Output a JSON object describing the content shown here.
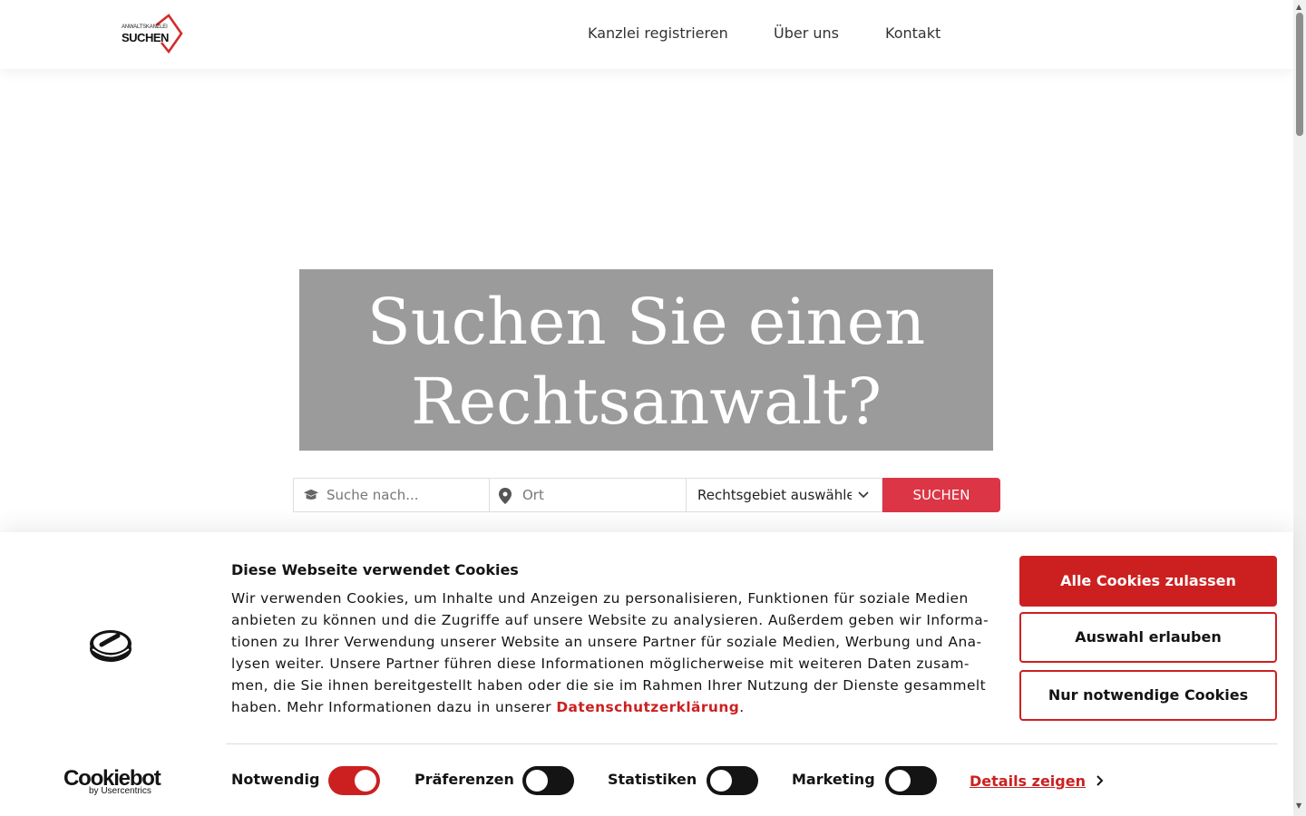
{
  "header": {
    "logo": {
      "top_text": "ANWALTSKANZLEI",
      "main_text": "SUCHEN"
    },
    "nav": [
      {
        "label": "Kanzlei registrieren"
      },
      {
        "label": "Über uns"
      },
      {
        "label": "Kontakt"
      }
    ]
  },
  "hero": {
    "title_line1": "Suchen Sie einen",
    "title_line2": "Rechtsanwalt?"
  },
  "search": {
    "query_placeholder": "Suche nach...",
    "location_placeholder": "Ort",
    "category_selected": "Rechtsgebiet auswählen",
    "button_label": "SUCHEN"
  },
  "cookie_banner": {
    "brand_name": "Cookiebot",
    "brand_by": "by Usercentrics",
    "title": "Diese Webseite verwendet Cookies",
    "text": "Wir verwenden Cookies, um Inhalte und Anzeigen zu personalisieren, Funktionen für soziale Medien anbieten zu können und die Zugriffe auf unsere Website zu analysieren. Außerdem geben wir Informa-tionen zu Ihrer Verwendung unserer Website an unsere Partner für soziale Medien, Werbung und Ana-lysen weiter. Unsere Partner führen diese Informationen möglicherweise mit weiteren Daten zusam-men, die Sie ihnen bereitgestellt haben oder die sie im Rahmen Ihrer Nutzung der Dienste gesammelt haben. Mehr Informationen dazu in unserer ",
    "privacy_link": "Datenschutzerklärung",
    "text_end": ".",
    "buttons": {
      "allow_all": "Alle Cookies zulassen",
      "allow_selection": "Auswahl erlauben",
      "necessary_only": "Nur notwendige Cookies"
    },
    "toggles": [
      {
        "label": "Notwendig",
        "on": true
      },
      {
        "label": "Präferenzen",
        "on": false
      },
      {
        "label": "Statistiken",
        "on": false
      },
      {
        "label": "Marketing",
        "on": false
      }
    ],
    "details_label": "Details zeigen"
  },
  "colors": {
    "accent": "#dc3545",
    "cookie_red": "#cc2020",
    "hero_bg": "#9b9b9b"
  }
}
